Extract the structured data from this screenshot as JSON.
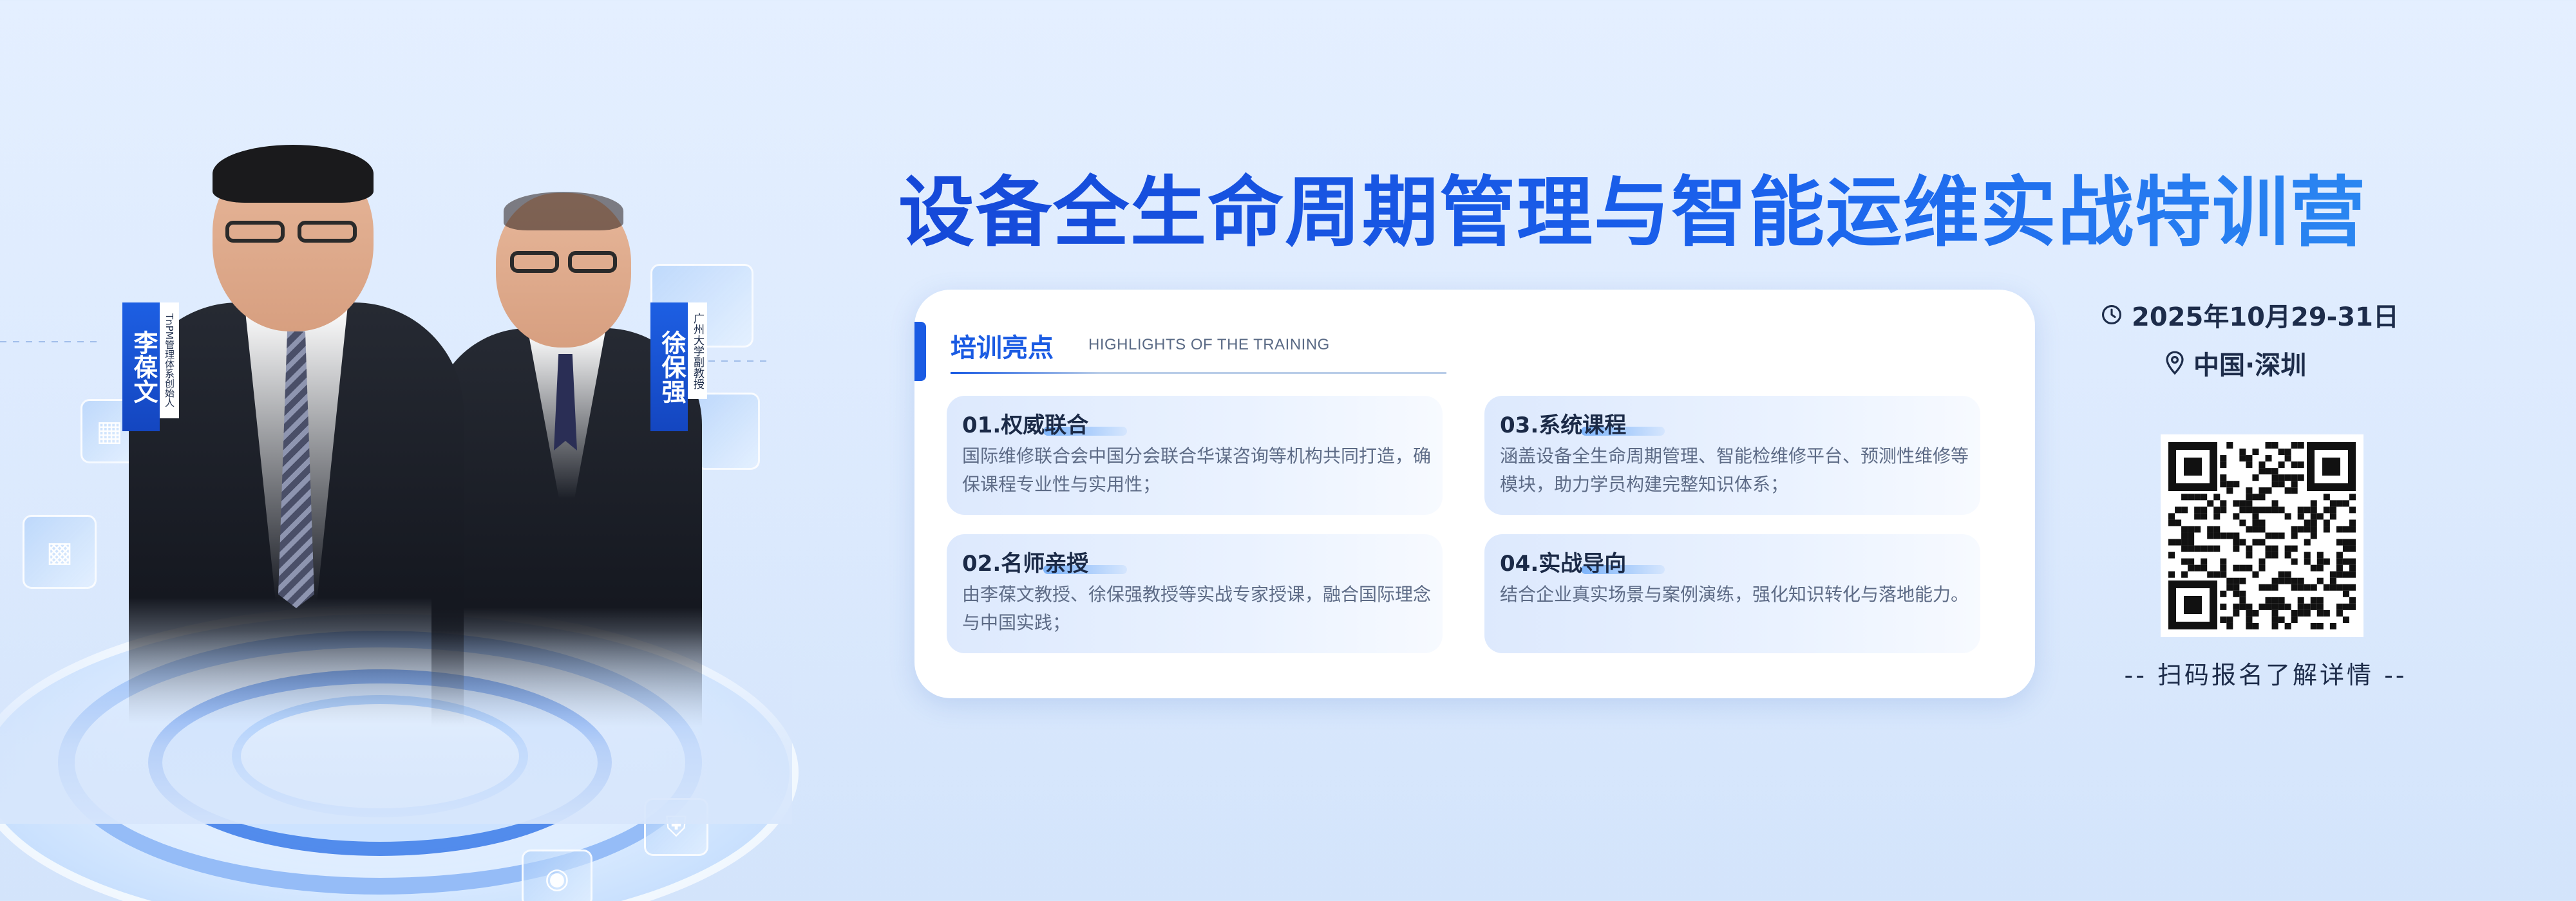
{
  "banner": {
    "title": "设备全生命周期管理与智能运维实战特训营"
  },
  "speakers": [
    {
      "name": "李葆文",
      "title": "TnPM管理体系创始人"
    },
    {
      "name": "徐保强",
      "title": "广州大学副教授"
    }
  ],
  "highlights": {
    "heading": "培训亮点",
    "heading_en": "HIGHLIGHTS OF THE TRAINING",
    "items": [
      {
        "label": "01.权威联合",
        "text": "国际维修联合会中国分会联合华谋咨询等机构共同打造，确保课程专业性与实用性；"
      },
      {
        "label": "02.名师亲授",
        "text": "由李葆文教授、徐保强教授等实战专家授课，融合国际理念与中国实践；"
      },
      {
        "label": "03.系统课程",
        "text": "涵盖设备全生命周期管理、智能检维修平台、预测性维修等模块，助力学员构建完整知识体系；"
      },
      {
        "label": "04.实战导向",
        "text": "结合企业真实场景与案例演练，强化知识转化与落地能力。"
      }
    ]
  },
  "event": {
    "date": "2025年10月29-31日",
    "location": "中国·深圳",
    "qr_caption": "-- 扫码报名了解详情 --"
  },
  "icons": {
    "date": "clock-icon",
    "location": "location-pin-icon"
  },
  "colors": {
    "accent": "#1a5be3",
    "title_start": "#1548d8",
    "title_end": "#2d8bf2",
    "background": "#dbe9fd"
  }
}
